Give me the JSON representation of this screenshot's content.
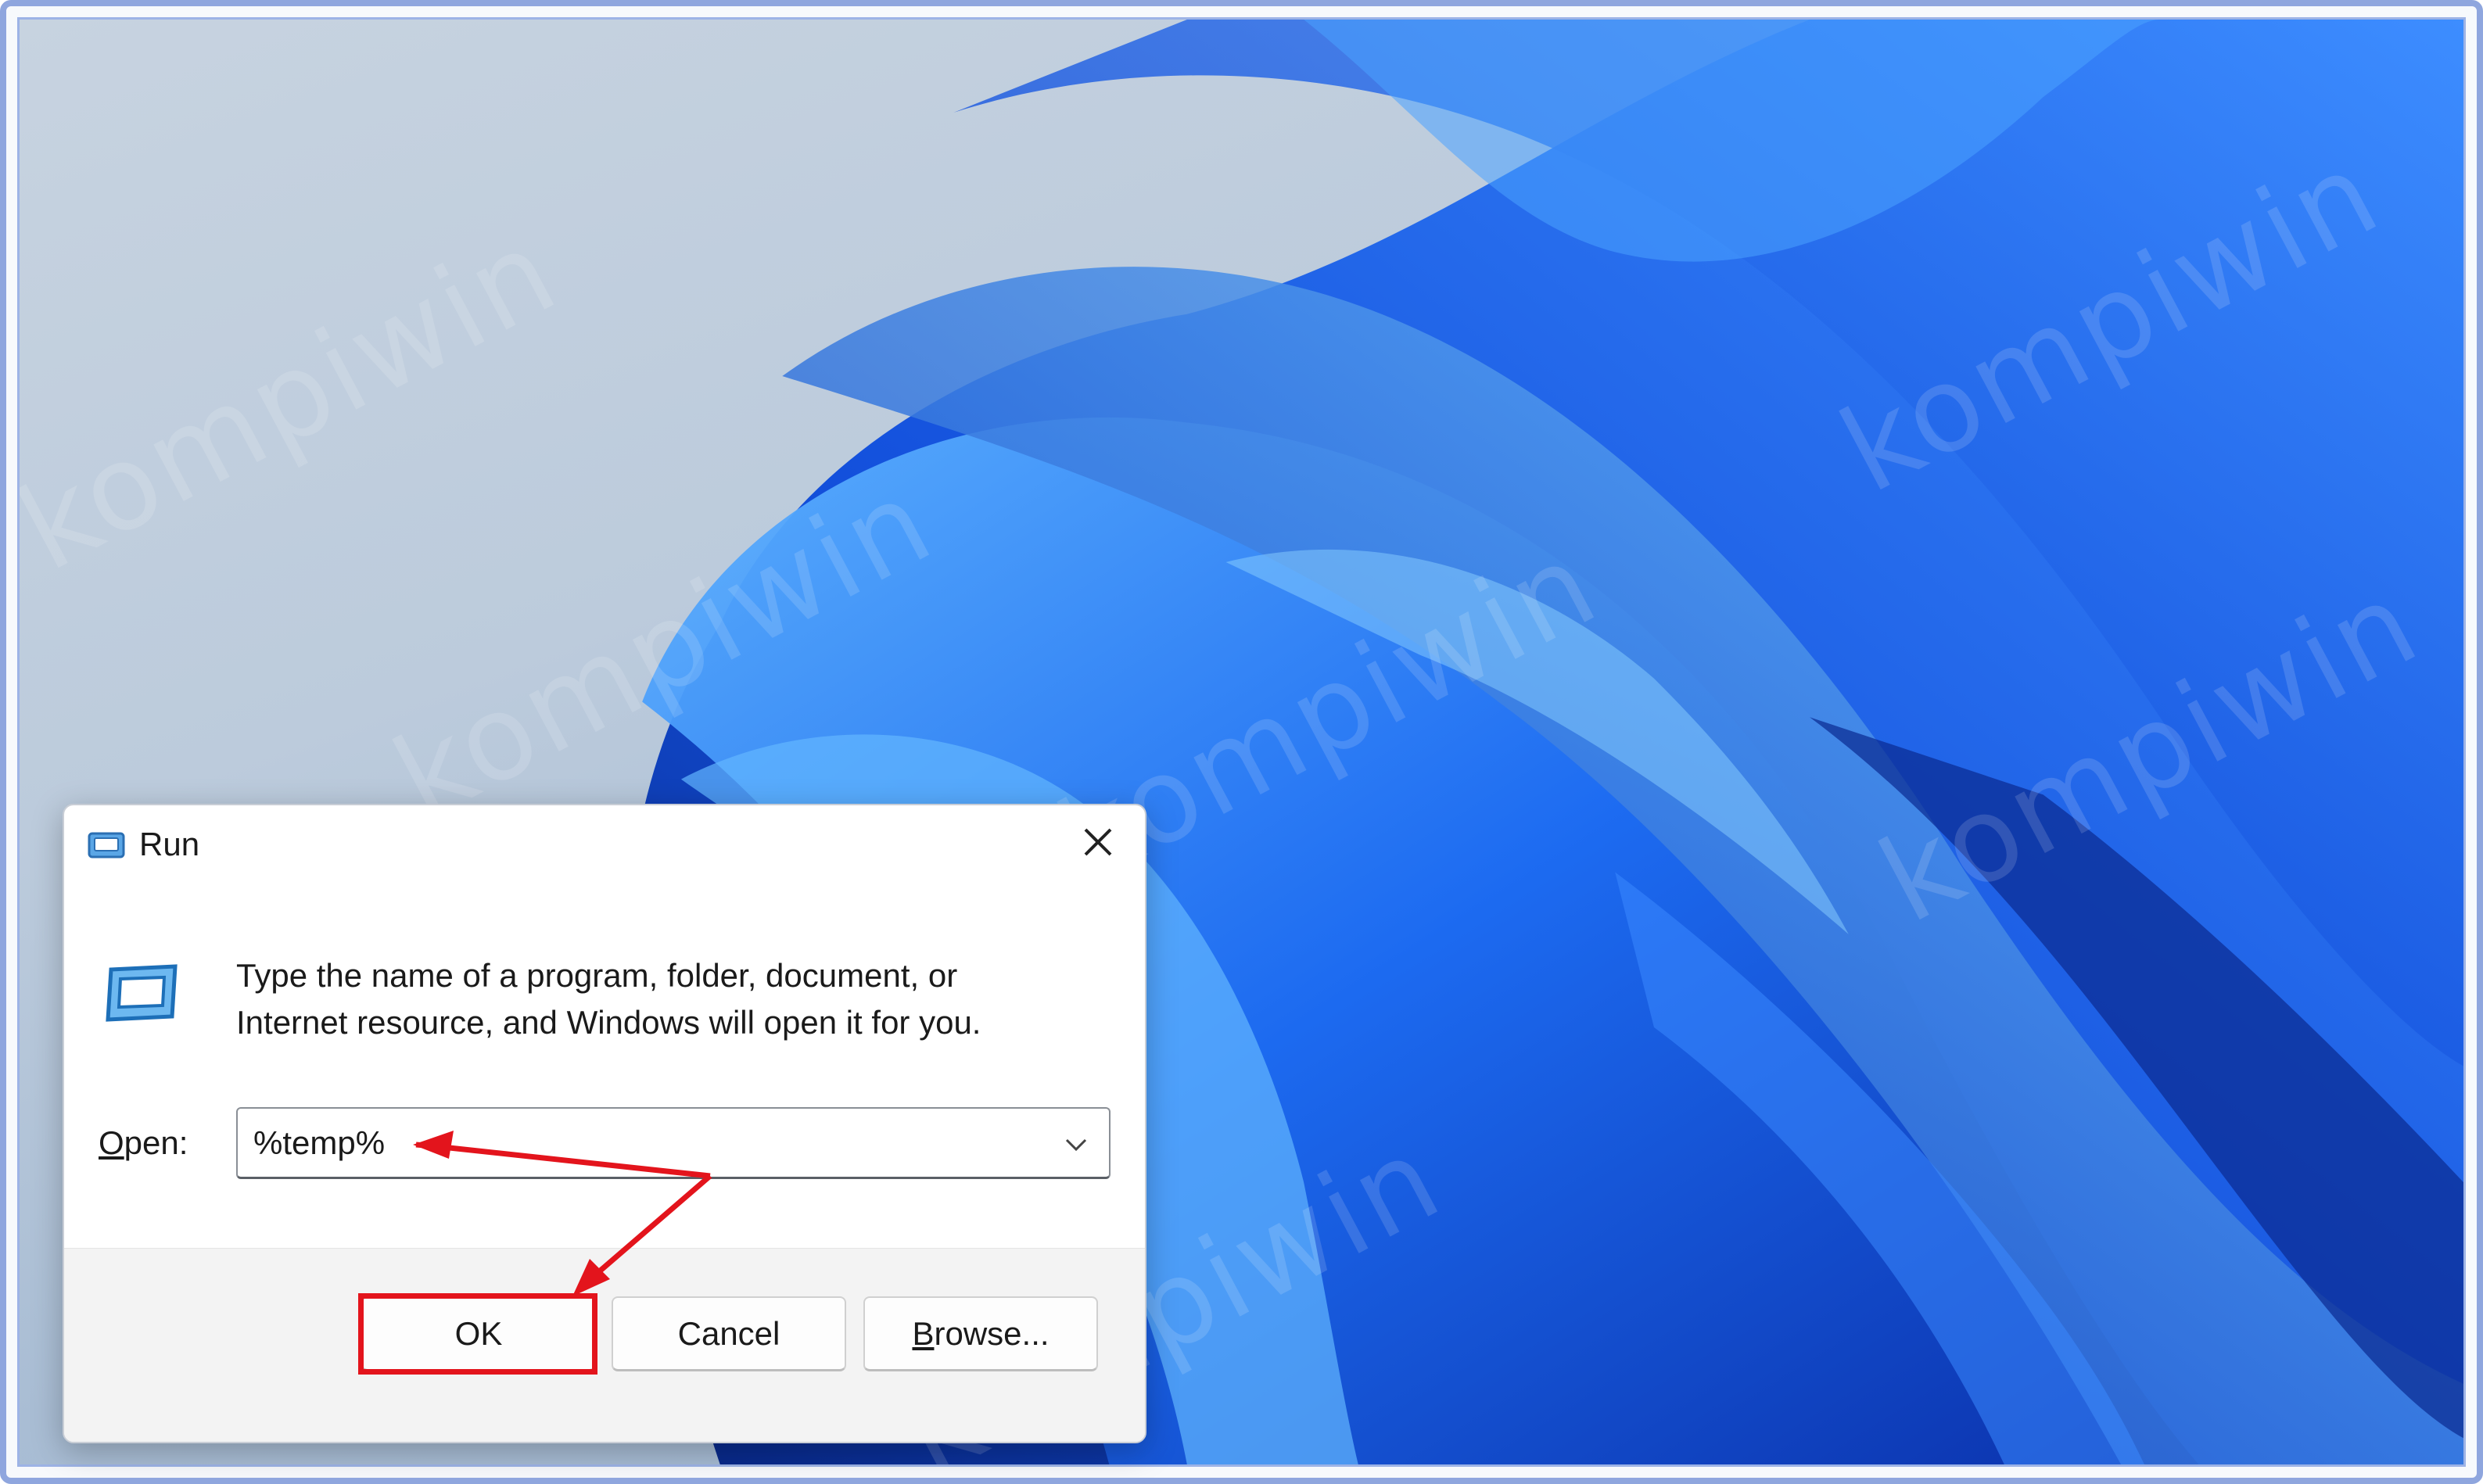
{
  "desktop": {
    "watermark": "kompiwin"
  },
  "run_dialog": {
    "title": "Run",
    "description_line1": "Type the name of a program, folder, document, or",
    "description_line2": "Internet resource, and Windows will open it for you.",
    "open_label_prefix": "O",
    "open_label_rest": "pen:",
    "open_value": "%temp%",
    "ok_label": "OK",
    "cancel_label": "Cancel",
    "browse_label_prefix": "B",
    "browse_label_rest": "rowse...",
    "icons": {
      "title": "run-icon",
      "body": "run-icon",
      "close": "close-icon",
      "dropdown": "chevron-down-icon"
    }
  },
  "annotations": {
    "highlight_color": "#e3141c",
    "arrow_color": "#e3141c"
  },
  "colors": {
    "wallpaper_blue": "#1a66f0",
    "wallpaper_light": "#4aa3ff",
    "wallpaper_dark": "#0a2fa8"
  }
}
